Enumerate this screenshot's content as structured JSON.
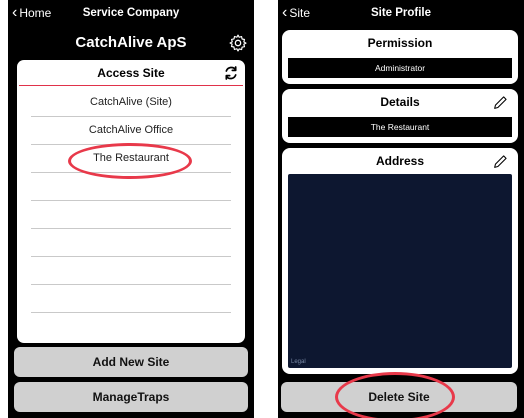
{
  "left_screen": {
    "back_label": "Home",
    "top_title": "Service Company",
    "company_name": "CatchAlive ApS",
    "card": {
      "header": "Access Site",
      "sites": [
        "CatchAlive (Site)",
        "CatchAlive Office",
        "The Restaurant"
      ]
    },
    "buttons": {
      "add_new_site": "Add New Site",
      "manage_traps": "ManageTraps"
    }
  },
  "right_screen": {
    "back_label": "Site",
    "top_title": "Site Profile",
    "permission": {
      "title": "Permission",
      "value": "Administrator"
    },
    "details": {
      "title": "Details",
      "value": "The Restaurant"
    },
    "address": {
      "title": "Address",
      "map_legal": "Legal"
    },
    "buttons": {
      "delete_site": "Delete Site"
    }
  },
  "colors": {
    "highlight": "#e8394a",
    "header_divider": "#e0324a"
  }
}
